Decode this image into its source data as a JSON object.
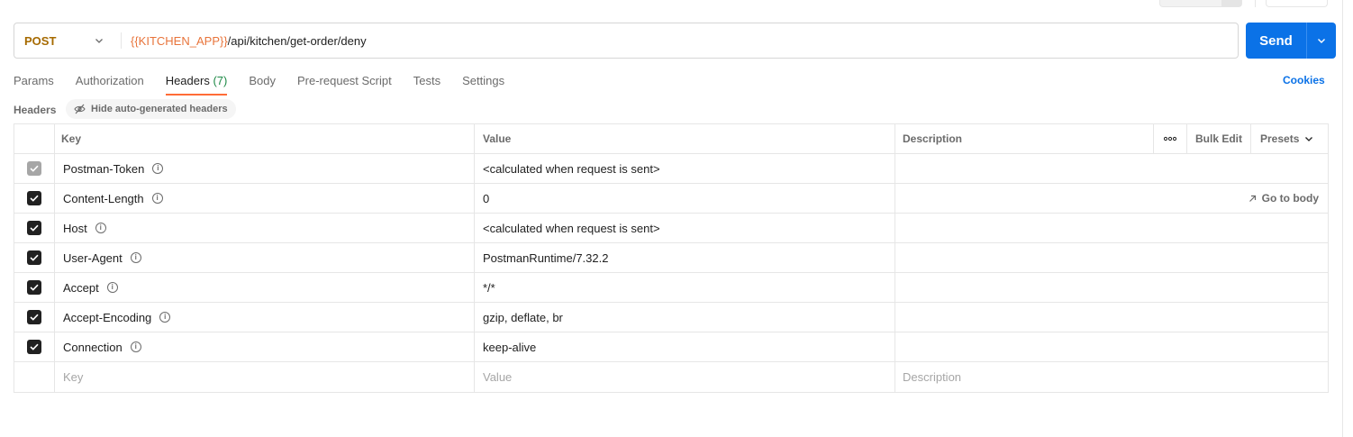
{
  "request": {
    "method": "POST",
    "url_variable": "{{KITCHEN_APP}}",
    "url_path": "/api/kitchen/get-order/deny",
    "send_label": "Send"
  },
  "tabs": [
    {
      "label": "Params"
    },
    {
      "label": "Authorization"
    },
    {
      "label": "Headers",
      "count": "(7)",
      "active": true
    },
    {
      "label": "Body"
    },
    {
      "label": "Pre-request Script"
    },
    {
      "label": "Tests"
    },
    {
      "label": "Settings"
    }
  ],
  "cookies_label": "Cookies",
  "headers_section": {
    "title": "Headers",
    "hide_button": "Hide auto-generated headers"
  },
  "table": {
    "columns": {
      "key": "Key",
      "value": "Value",
      "description": "Description",
      "bulk_edit": "Bulk Edit",
      "presets": "Presets"
    },
    "rows": [
      {
        "key": "Postman-Token",
        "value": "<calculated when request is sent>",
        "checked": true,
        "disabled": true
      },
      {
        "key": "Content-Length",
        "value": "0",
        "checked": true,
        "action": "Go to body"
      },
      {
        "key": "Host",
        "value": "<calculated when request is sent>",
        "checked": true
      },
      {
        "key": "User-Agent",
        "value": "PostmanRuntime/7.32.2",
        "checked": true
      },
      {
        "key": "Accept",
        "value": "*/*",
        "checked": true
      },
      {
        "key": "Accept-Encoding",
        "value": "gzip, deflate, br",
        "checked": true
      },
      {
        "key": "Connection",
        "value": "keep-alive",
        "checked": true
      }
    ],
    "new_row": {
      "key_placeholder": "Key",
      "value_placeholder": "Value",
      "description_placeholder": "Description"
    }
  },
  "colors": {
    "accent": "#ff6c37",
    "send_button": "#0b72e7",
    "method_post": "#a66a00",
    "url_variable": "#e8743b",
    "count_green": "#1e8a47"
  }
}
